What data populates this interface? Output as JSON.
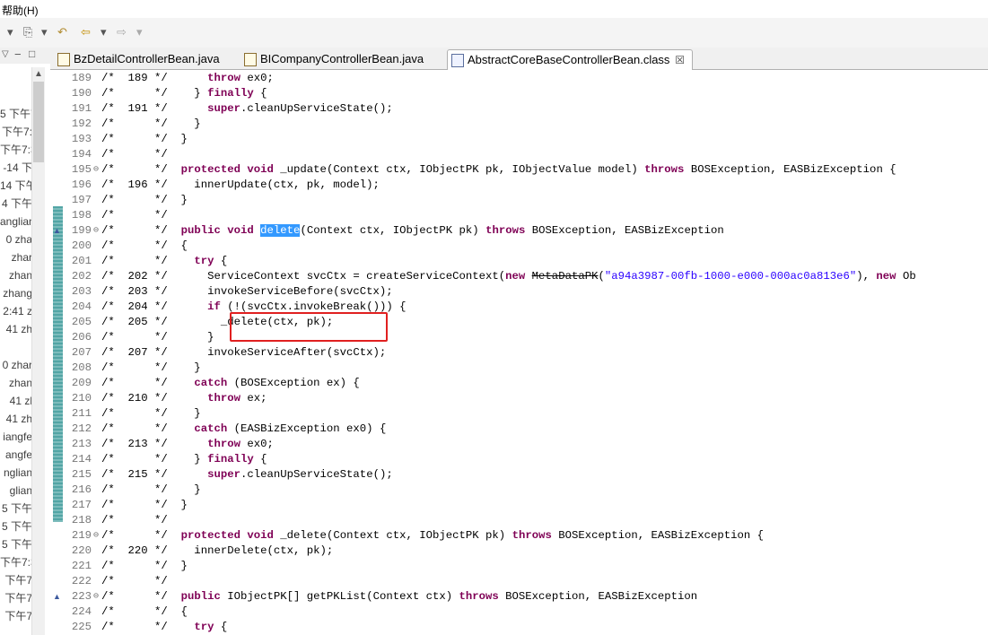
{
  "menubar": {
    "help_label": "帮助(H)"
  },
  "tabs": [
    {
      "label": "BzDetailControllerBean.java",
      "icon": "java-file-icon"
    },
    {
      "label": "BICompanyControllerBean.java",
      "icon": "java-file-icon"
    },
    {
      "label": "AbstractCoreBaseControllerBean.class",
      "icon": "class-file-icon",
      "active": true
    }
  ],
  "left_panel": {
    "lines": [
      "5 下午7",
      "下午7:",
      "下午7:3",
      "-14 下",
      "14 下午",
      "4 下午",
      "anglian",
      "0 zha",
      "zhar",
      "zhan",
      "zhang",
      "2:41 z",
      "41 zh",
      "",
      "0 zhar",
      "zhan",
      "41 zl",
      "41 zh",
      "iangfe",
      "angfe",
      "nglian",
      "glian",
      "5 下午",
      "5 下午",
      "5 下午",
      "下午7:3",
      "下午7",
      "下午7",
      "下午7"
    ]
  },
  "editor": {
    "lines": [
      {
        "n": "189",
        "c": "/*  189 */      <k>throw</k> ex0;"
      },
      {
        "n": "190",
        "c": "/*      */    } <k>finally</k> {"
      },
      {
        "n": "191",
        "c": "/*  191 */      <k>super</k>.cleanUpServiceState();"
      },
      {
        "n": "192",
        "c": "/*      */    }"
      },
      {
        "n": "193",
        "c": "/*      */  }"
      },
      {
        "n": "194",
        "c": "/*      */"
      },
      {
        "n": "195",
        "c": "/*      */  <k>protected</k> <k>void</k> _update(Context ctx, IObjectPK pk, IObjectValue model) <k>throws</k> BOSException, EASBizException {"
      },
      {
        "n": "196",
        "c": "/*  196 */    innerUpdate(ctx, pk, model);"
      },
      {
        "n": "197",
        "c": "/*      */  }"
      },
      {
        "n": "198",
        "c": "/*      */"
      },
      {
        "n": "199",
        "c": "/*      */  <k>public</k> <k>void</k> <sel>delete</sel>(Context ctx, IObjectPK pk) <k>throws</k> BOSException, EASBizException"
      },
      {
        "n": "200",
        "c": "/*      */  {"
      },
      {
        "n": "201",
        "c": "/*      */    <k>try</k> {"
      },
      {
        "n": "202",
        "c": "/*  202 */      ServiceContext svcCtx = createServiceContext(<k>new</k> <s>MetaDataPK</s>(<q>\"a94a3987-00fb-1000-e000-000ac0a813e6\"</q>), <k>new</k> Ob"
      },
      {
        "n": "203",
        "c": "/*  203 */      invokeServiceBefore(svcCtx);"
      },
      {
        "n": "204",
        "c": "/*  204 */      <k>if</k> (!(svcCtx.invokeBreak())) {"
      },
      {
        "n": "205",
        "c": "/*  205 */        _delete(ctx, pk);"
      },
      {
        "n": "206",
        "c": "/*      */      }"
      },
      {
        "n": "207",
        "c": "/*  207 */      invokeServiceAfter(svcCtx);"
      },
      {
        "n": "208",
        "c": "/*      */    }"
      },
      {
        "n": "209",
        "c": "/*      */    <k>catch</k> (BOSException ex) {"
      },
      {
        "n": "210",
        "c": "/*  210 */      <k>throw</k> ex;"
      },
      {
        "n": "211",
        "c": "/*      */    }"
      },
      {
        "n": "212",
        "c": "/*      */    <k>catch</k> (EASBizException ex0) {"
      },
      {
        "n": "213",
        "c": "/*  213 */      <k>throw</k> ex0;"
      },
      {
        "n": "214",
        "c": "/*      */    } <k>finally</k> {"
      },
      {
        "n": "215",
        "c": "/*  215 */      <k>super</k>.cleanUpServiceState();"
      },
      {
        "n": "216",
        "c": "/*      */    }"
      },
      {
        "n": "217",
        "c": "/*      */  }"
      },
      {
        "n": "218",
        "c": "/*      */"
      },
      {
        "n": "219",
        "c": "/*      */  <k>protected</k> <k>void</k> _delete(Context ctx, IObjectPK pk) <k>throws</k> BOSException, EASBizException {"
      },
      {
        "n": "220",
        "c": "/*  220 */    innerDelete(ctx, pk);"
      },
      {
        "n": "221",
        "c": "/*      */  }"
      },
      {
        "n": "222",
        "c": "/*      */"
      },
      {
        "n": "223",
        "c": "/*      */  <k>public</k> IObjectPK[] getPKList(Context ctx) <k>throws</k> BOSException, EASBizException"
      },
      {
        "n": "224",
        "c": "/*      */  {"
      },
      {
        "n": "225",
        "c": "/*      */    <k>try</k> {"
      }
    ],
    "fold_markers": [
      "195",
      "199",
      "219",
      "223"
    ]
  },
  "colors": {
    "keyword": "#7f0055",
    "string": "#2a00ff",
    "selection": "#3399ff",
    "highlight_box": "#e02020"
  }
}
